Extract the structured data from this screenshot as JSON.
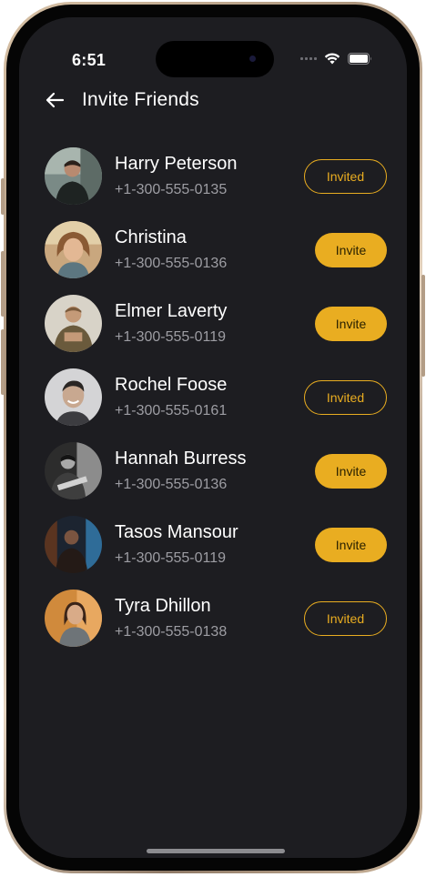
{
  "status_bar": {
    "time": "6:51"
  },
  "header": {
    "title": "Invite Friends"
  },
  "contacts": [
    {
      "name": "Harry Peterson",
      "phone": "+1-300-555-0135",
      "action": "Invited",
      "state": "invited"
    },
    {
      "name": "Christina",
      "phone": "+1-300-555-0136",
      "action": "Invite",
      "state": "invite"
    },
    {
      "name": "Elmer Laverty",
      "phone": "+1-300-555-0119",
      "action": "Invite",
      "state": "invite"
    },
    {
      "name": "Rochel Foose",
      "phone": "+1-300-555-0161",
      "action": "Invited",
      "state": "invited"
    },
    {
      "name": "Hannah Burress",
      "phone": "+1-300-555-0136",
      "action": "Invite",
      "state": "invite"
    },
    {
      "name": "Tasos Mansour",
      "phone": "+1-300-555-0119",
      "action": "Invite",
      "state": "invite"
    },
    {
      "name": "Tyra Dhillon",
      "phone": "+1-300-555-0138",
      "action": "Invited",
      "state": "invited"
    }
  ],
  "colors": {
    "background": "#1d1d21",
    "accent": "#e9ad21",
    "secondary_text": "#9d9da3"
  },
  "icons": {
    "back": "arrow-left-icon",
    "wifi": "wifi-icon",
    "battery": "battery-icon",
    "signal": "cellular-signal-icon"
  }
}
